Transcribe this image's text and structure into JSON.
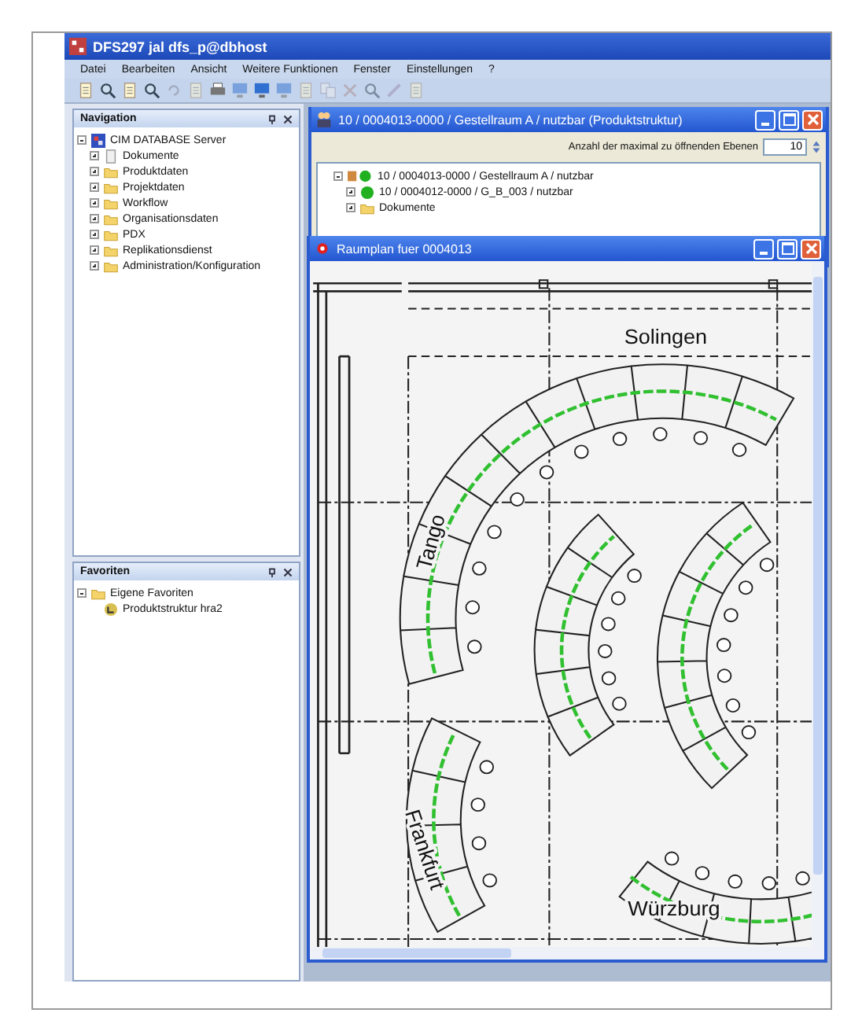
{
  "window": {
    "title": "DFS297 jal dfs_p@dbhost"
  },
  "menu": [
    "Datei",
    "Bearbeiten",
    "Ansicht",
    "Weitere Funktionen",
    "Fenster",
    "Einstellungen",
    "?"
  ],
  "navigation": {
    "title": "Navigation",
    "tree": [
      {
        "label": "CIM DATABASE Server",
        "kind": "server",
        "expanded": true,
        "children": [
          {
            "label": "Dokumente",
            "kind": "document",
            "expanded": false
          },
          {
            "label": "Produktdaten",
            "kind": "folder",
            "expanded": false
          },
          {
            "label": "Projektdaten",
            "kind": "folder",
            "expanded": false
          },
          {
            "label": "Workflow",
            "kind": "folder",
            "expanded": false
          },
          {
            "label": "Organisationsdaten",
            "kind": "folder",
            "expanded": false
          },
          {
            "label": "PDX",
            "kind": "folder",
            "expanded": false
          },
          {
            "label": "Replikationsdienst",
            "kind": "folder",
            "expanded": false
          },
          {
            "label": "Administration/Konfiguration",
            "kind": "folder",
            "expanded": false
          }
        ]
      }
    ]
  },
  "favorites": {
    "title": "Favoriten",
    "tree": [
      {
        "label": "Eigene Favoriten",
        "kind": "folder",
        "expanded": true,
        "children": [
          {
            "label": "Produktstruktur hra2",
            "kind": "favorite"
          }
        ]
      }
    ]
  },
  "product_window": {
    "title": "10 / 0004013-0000 / Gestellraum A / nutzbar (Produktstruktur)",
    "levels_label": "Anzahl der maximal zu öffnenden Ebenen",
    "levels_value": "10",
    "tree": [
      {
        "label": "10 / 0004013-0000 / Gestellraum A / nutzbar",
        "kind": "assembly",
        "expanded": true,
        "children": [
          {
            "label": "10 / 0004012-0000 / G_B_003 / nutzbar",
            "kind": "part",
            "expanded": false
          },
          {
            "label": "Dokumente",
            "kind": "folder",
            "expanded": false
          }
        ]
      }
    ]
  },
  "plan_window": {
    "title": "Raumplan fuer 0004013",
    "room_labels": [
      "Solingen",
      "Tango",
      "Frankfurt",
      "Würzburg"
    ]
  }
}
